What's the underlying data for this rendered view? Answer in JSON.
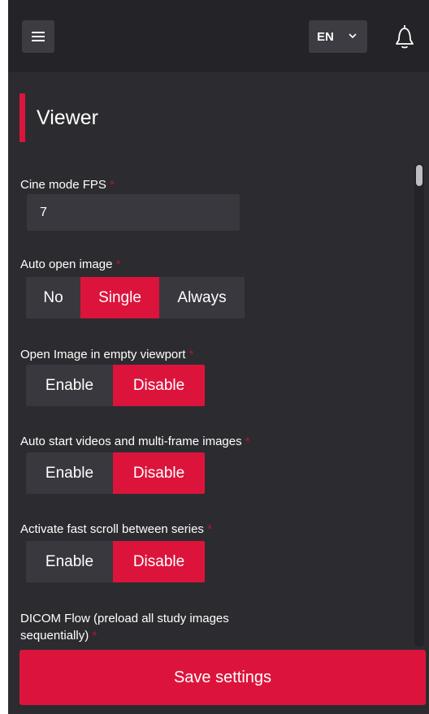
{
  "header": {
    "language": "EN"
  },
  "section": {
    "title": "Viewer"
  },
  "settings": {
    "cine_fps": {
      "label": "Cine mode FPS",
      "required": "*",
      "value": "7"
    },
    "auto_open": {
      "label": "Auto open image",
      "required": "*",
      "options": [
        "No",
        "Single",
        "Always"
      ],
      "selected": "Single"
    },
    "empty_viewport": {
      "label": "Open Image in empty viewport",
      "required": "*",
      "options": [
        "Enable",
        "Disable"
      ],
      "selected": "Disable"
    },
    "auto_start": {
      "label": "Auto start videos and multi-frame images",
      "required": "*",
      "options": [
        "Enable",
        "Disable"
      ],
      "selected": "Disable"
    },
    "fast_scroll": {
      "label": "Activate fast scroll between series",
      "required": "*",
      "options": [
        "Enable",
        "Disable"
      ],
      "selected": "Disable"
    },
    "dicom_flow": {
      "label_line1": "DICOM Flow (preload all study images",
      "label_line2": "sequentially)",
      "required": "*"
    }
  },
  "save_label": "Save settings",
  "colors": {
    "accent": "#dc143c",
    "background": "#2c2c30",
    "topbar": "#242428",
    "control": "#38383e"
  }
}
